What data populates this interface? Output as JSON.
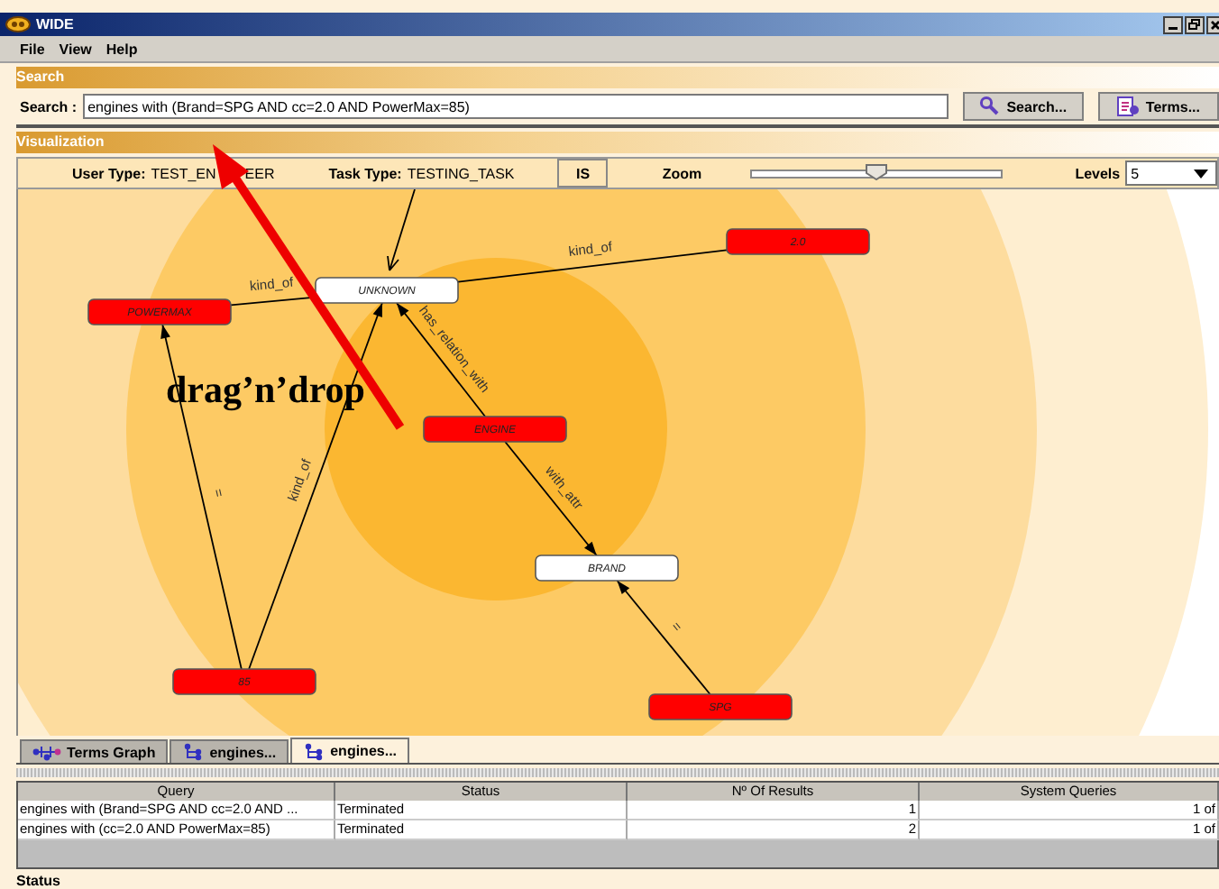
{
  "window": {
    "title": "WIDE"
  },
  "menu": [
    "File",
    "View",
    "Help"
  ],
  "search_section": {
    "title": "Search",
    "label": "Search :",
    "value": "engines with (Brand=SPG AND cc=2.0 AND PowerMax=85)",
    "buttons": [
      "Search...",
      "Terms..."
    ]
  },
  "visualization": {
    "title": "Visualization",
    "toolbar": {
      "user_type_label": "User Type:",
      "user_type_start": "TEST_EN",
      "user_type_end": "EER",
      "task_type_label": "Task Type:",
      "task_type": "TESTING_TASK",
      "is_button": "IS",
      "zoom_label": "Zoom",
      "zoom": {
        "level": 0.5
      },
      "levels_label": "Levels",
      "levels_value": "5"
    },
    "nodes": [
      {
        "label": "POWERMAX",
        "highlighted": true
      },
      {
        "label": "UNKNOWN",
        "highlighted": false
      },
      {
        "label": "2.0",
        "highlighted": true
      },
      {
        "label": "ENGINE",
        "highlighted": true
      },
      {
        "label": "BRAND",
        "highlighted": false
      },
      {
        "label": "85",
        "highlighted": true
      },
      {
        "label": "SPG",
        "highlighted": true
      }
    ],
    "edges": [
      {
        "label": "kind_of",
        "arrow": false
      },
      {
        "label": "kind_of",
        "arrow": false
      },
      {
        "label": "has_relation_with",
        "arrow": true
      },
      {
        "label": "with_attr",
        "arrow": true
      },
      {
        "label": "=",
        "arrow": true
      },
      {
        "label": "kind_of",
        "arrow": true
      },
      {
        "label": "=",
        "arrow": true
      }
    ],
    "tabs": [
      {
        "label": "Terms Graph",
        "kind": "terms",
        "selected": false
      },
      {
        "label": "engines...",
        "kind": "query",
        "selected": false
      },
      {
        "label": "engines...",
        "kind": "query",
        "selected": true
      }
    ]
  },
  "table": {
    "columns": [
      "Query",
      "Status",
      "Nº Of Results",
      "System Queries"
    ],
    "rows": [
      [
        "engines with (Brand=SPG AND cc=2.0 AND ...",
        "Terminated",
        "1",
        "1 of"
      ],
      [
        "engines with (cc=2.0 AND PowerMax=85)",
        "Terminated",
        "2",
        "1 of"
      ]
    ]
  },
  "status_bar": "Status",
  "annotation": {
    "text": "drag’n’drop"
  }
}
